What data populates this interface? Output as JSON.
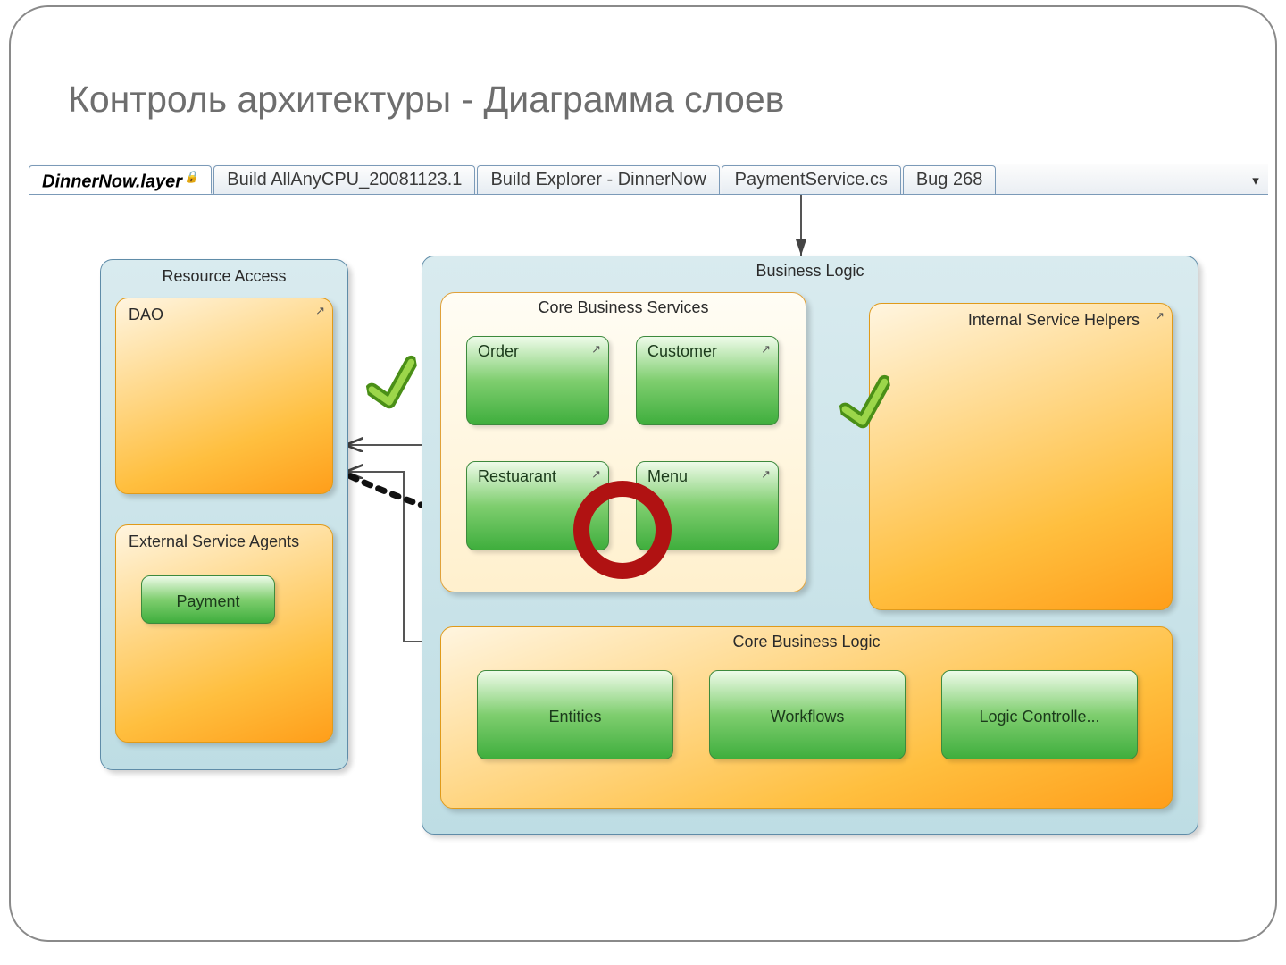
{
  "title": "Контроль архитектуры - Диаграмма слоев",
  "tabs": {
    "active": "DinnerNow.layer",
    "others": [
      "Build AllAnyCPU_20081123.1",
      "Build Explorer - DinnerNow",
      "PaymentService.cs",
      "Bug 268"
    ]
  },
  "layers": {
    "resource_access": {
      "title": "Resource Access",
      "dao": "DAO",
      "ext_agents": "External Service Agents",
      "payment": "Payment"
    },
    "business_logic": {
      "title": "Business Logic",
      "core_services": {
        "title": "Core Business Services",
        "order": "Order",
        "customer": "Customer",
        "restaurant": "Restuarant",
        "menu": "Menu"
      },
      "helpers": "Internal Service Helpers",
      "core_logic": {
        "title": "Core Business Logic",
        "entities": "Entities",
        "workflows": "Workflows",
        "controllers": "Logic Controlle..."
      }
    }
  }
}
